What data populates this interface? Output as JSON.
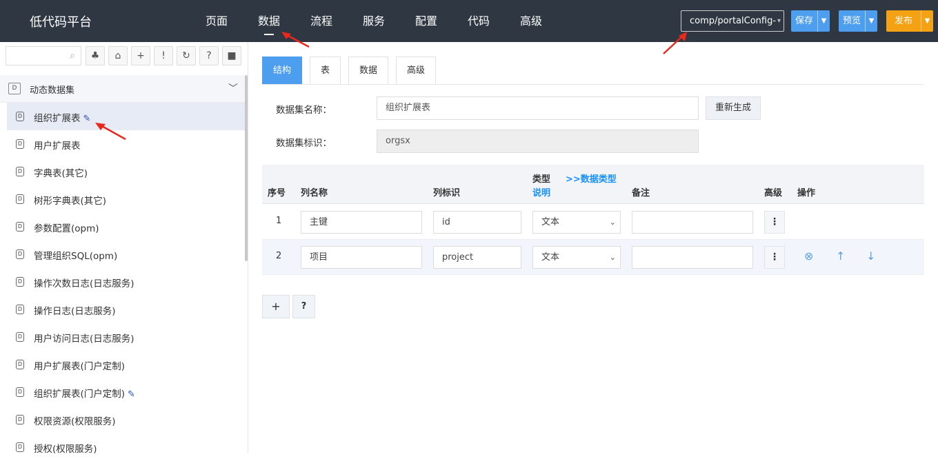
{
  "app": {
    "title": "低代码平台"
  },
  "nav": {
    "items": [
      "页面",
      "数据",
      "流程",
      "服务",
      "配置",
      "代码",
      "高级"
    ],
    "active_index": 1
  },
  "project_select": {
    "value": "comp/portalConfig-"
  },
  "actions": {
    "save": "保存",
    "preview": "预览",
    "publish": "发布"
  },
  "colors": {
    "topbar": "#2f3842",
    "accent": "#4e9ef0",
    "publish": "#f5a114",
    "link": "#1890ff"
  },
  "toolbar": {
    "icons": [
      "search-icon",
      "tree-icon",
      "tag-icon",
      "plus-icon",
      "exclamation-icon",
      "refresh-icon",
      "help-icon",
      "message-icon"
    ]
  },
  "sidebar": {
    "group_label": "动态数据集",
    "items": [
      {
        "label": "组织扩展表",
        "edit": true
      },
      {
        "label": "用户扩展表",
        "edit": false
      },
      {
        "label": "字典表(其它)",
        "edit": false
      },
      {
        "label": "树形字典表(其它)",
        "edit": false
      },
      {
        "label": "参数配置(opm)",
        "edit": false
      },
      {
        "label": "管理组织SQL(opm)",
        "edit": false
      },
      {
        "label": "操作次数日志(日志服务)",
        "edit": false
      },
      {
        "label": "操作日志(日志服务)",
        "edit": false
      },
      {
        "label": "用户访问日志(日志服务)",
        "edit": false
      },
      {
        "label": "用户扩展表(门户定制)",
        "edit": false
      },
      {
        "label": "组织扩展表(门户定制)",
        "edit": true
      },
      {
        "label": "权限资源(权限服务)",
        "edit": false
      },
      {
        "label": "授权(权限服务)",
        "edit": false
      }
    ]
  },
  "tabs": [
    "结构",
    "表",
    "数据",
    "高级"
  ],
  "form": {
    "name_label": "数据集名称：",
    "name_value": "组织扩展表",
    "regen_button": "重新生成",
    "id_label": "数据集标识：",
    "id_value": "orgsx"
  },
  "grid": {
    "headers": {
      "seq": "序号",
      "col_name": "列名称",
      "col_id": "列标识",
      "type": "类型",
      "type_link": ">>数据类型",
      "type_desc": "说明",
      "remark": "备注",
      "advanced": "高级",
      "ops": "操作"
    },
    "rows": [
      {
        "seq": "1",
        "name": "主键",
        "id": "id",
        "type": "文本",
        "remark": ""
      },
      {
        "seq": "2",
        "name": "项目",
        "id": "project",
        "type": "文本",
        "remark": ""
      }
    ],
    "more_glyph": "⋮",
    "add_glyph": "+",
    "help_glyph": "?"
  }
}
